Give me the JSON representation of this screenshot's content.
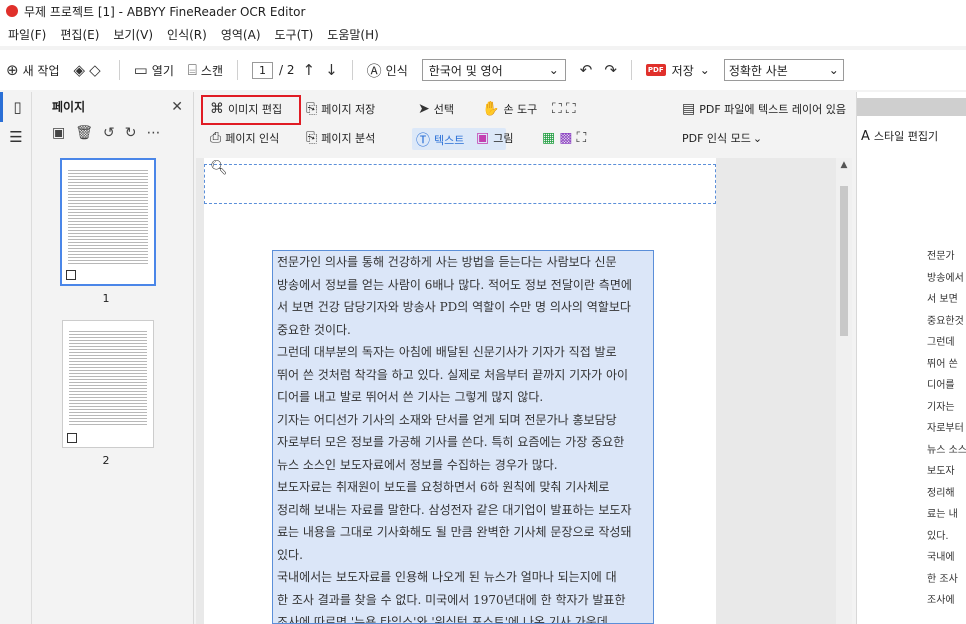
{
  "window": {
    "title": "무제 프로젝트 [1] - ABBYY FineReader OCR Editor"
  },
  "menubar": {
    "items": [
      "파일(F)",
      "편집(E)",
      "보기(V)",
      "인식(R)",
      "영역(A)",
      "도구(T)",
      "도움말(H)"
    ]
  },
  "toolbar": {
    "new_task": "새 작업",
    "open": "열기",
    "scan": "스캔",
    "page_current": "1",
    "page_total": "/ 2",
    "recognize": "인식",
    "language": "한국어 및 영어",
    "save": "저장",
    "pdf_badge": "PDF",
    "save_mode": "정확한 사본"
  },
  "pages_panel": {
    "title": "페이지",
    "thumbnails": [
      {
        "label": "1",
        "selected": true
      },
      {
        "label": "2",
        "selected": false
      }
    ]
  },
  "ribbon": {
    "edit_image": "이미지 편집",
    "save_page": "페이지 저장",
    "select": "선택",
    "hand_tool": "손 도구",
    "pdf_text_layer": "PDF 파일에 텍스트 레이어 있음",
    "page_recognize": "페이지 인식",
    "page_analyze": "페이지 분석",
    "text": "텍스트",
    "picture": "그림",
    "pdf_recognize_mode": "PDF 인식 모드"
  },
  "right_panel": {
    "style_editor": "스타일 편집기"
  },
  "document": {
    "lines": [
      "  전문가인 의사를 통해 건강하게 사는 방법을 듣는다는 사람보다 신문",
      "방송에서 정보를 얻는 사람이 6배나 많다. 적어도 정보 전달이란 측면에",
      "서 보면 건강 담당기자와 방송사 PD의 역할이 수만 명 의사의 역할보다",
      "중요한 것이다.",
      "  그런데 대부분의 독자는 아침에 배달된 신문기사가 기자가 직접 발로",
      "뛰어 쓴 것처럼 착각을 하고 있다. 실제로 처음부터 끝까지 기자가 아이",
      "디어를 내고 발로 뛰어서 쓴 기사는 그렇게 많지 않다.",
      "  기자는 어디선가 기사의 소재와 단서를 얻게 되며 전문가나 홍보담당",
      "자로부터 모은 정보를 가공해 기사를 쓴다. 특히 요즘에는 가장 중요한",
      "뉴스 소스인 보도자료에서 정보를 수집하는 경우가 많다.",
      "  보도자료는 취재원이 보도를 요청하면서 6하 원칙에 맞춰 기사체로",
      "정리해 보내는 자료를 말한다. 삼성전자 같은 대기업이 발표하는 보도자",
      "료는 내용을 그대로 기사화해도 될 만큼 완벽한 기사체 문장으로 작성돼",
      "있다.",
      "  국내에서는 보도자료를 인용해 나오게 된 뉴스가 얼마나 되는지에 대",
      "한 조사 결과를 찾을 수 없다. 미국에서 1970년대에 한 학자가 발표한",
      "조사에 따르면 '뉴욕 타임스'와 '워싱턴 포스트'에 나온 기사 가운데"
    ],
    "right_lines": [
      "전문가",
      "방송에서",
      "서 보면",
      "중요한것",
      "그런데",
      "뛰어 쓴",
      "디어를",
      "기자는",
      "자로부터",
      "뉴스 소스",
      "보도자",
      "정리해",
      "료는 내",
      "있다.",
      "국내에",
      "한 조사",
      "조사에"
    ]
  }
}
